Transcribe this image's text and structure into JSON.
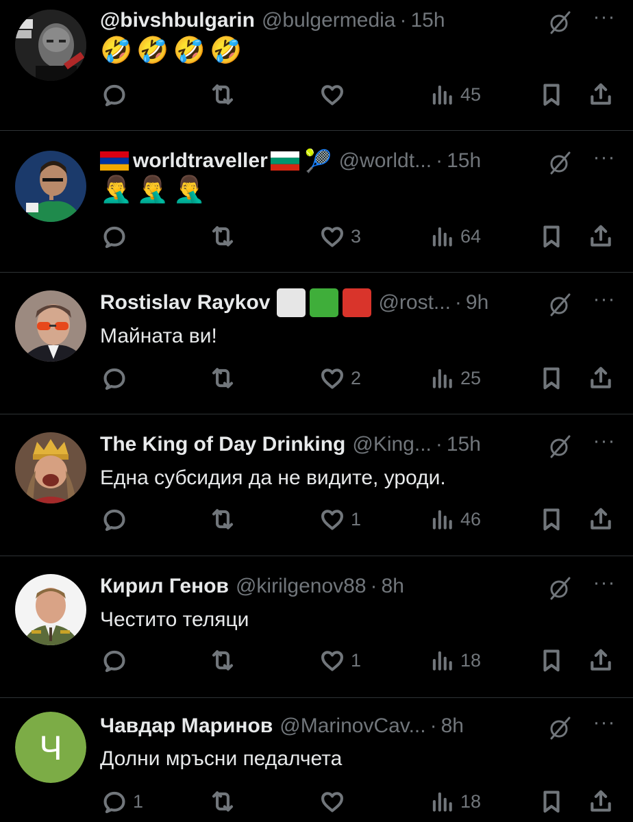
{
  "tweets": [
    {
      "name": "@bivshbulgarin",
      "handle": "@bulgermedia",
      "time": "15h",
      "text": "🤣🤣🤣🤣",
      "replies": "",
      "reposts": "",
      "likes": "",
      "views": "45",
      "avatar": "photo-man-dark"
    },
    {
      "name": "worldtraveller",
      "handle": "@worldt...",
      "time": "15h",
      "text": "🤦‍♂️🤦‍♂️🤦‍♂️",
      "replies": "",
      "reposts": "",
      "likes": "3",
      "views": "64",
      "avatar": "photo-tennis-player",
      "prefix_flag": "armenia",
      "suffix_flag": "bulgaria",
      "suffix_emoji": "🎾"
    },
    {
      "name": "Rostislav Raykov",
      "handle": "@rost...",
      "time": "9h",
      "text": "Майната ви!",
      "replies": "",
      "reposts": "",
      "likes": "2",
      "views": "25",
      "avatar": "photo-man-red-glasses",
      "squares": [
        "#e6e6e6",
        "#3fae3a",
        "#d9342b"
      ]
    },
    {
      "name": "The King of Day Drinking",
      "handle": "@King...",
      "time": "15h",
      "text": "Една субсидия да не видите, уроди.",
      "replies": "",
      "reposts": "",
      "likes": "1",
      "views": "46",
      "avatar": "photo-king-crown"
    },
    {
      "name": "Кирил Генов",
      "handle": "@kirilgenov88",
      "time": "8h",
      "text": "Честито теляци",
      "replies": "",
      "reposts": "",
      "likes": "1",
      "views": "18",
      "avatar": "photo-man-uniform"
    },
    {
      "name": "Чавдар Маринов",
      "handle": "@MarinovCav...",
      "time": "8h",
      "text": "Долни мръсни педалчета",
      "replies": "1",
      "reposts": "",
      "likes": "",
      "views": "18",
      "avatar": "letter-avatar",
      "avatar_letter": "Ч",
      "avatar_color": "#7cac46"
    }
  ],
  "icons": {
    "reply": "reply-icon",
    "repost": "repost-icon",
    "like": "heart-icon",
    "views": "views-icon",
    "bookmark": "bookmark-icon",
    "share": "share-icon",
    "grok": "grok-icon",
    "more": "more-icon"
  },
  "colors": {
    "background": "#000000",
    "text": "#e7e9ea",
    "muted": "#71767b",
    "divider": "#2f3336"
  }
}
